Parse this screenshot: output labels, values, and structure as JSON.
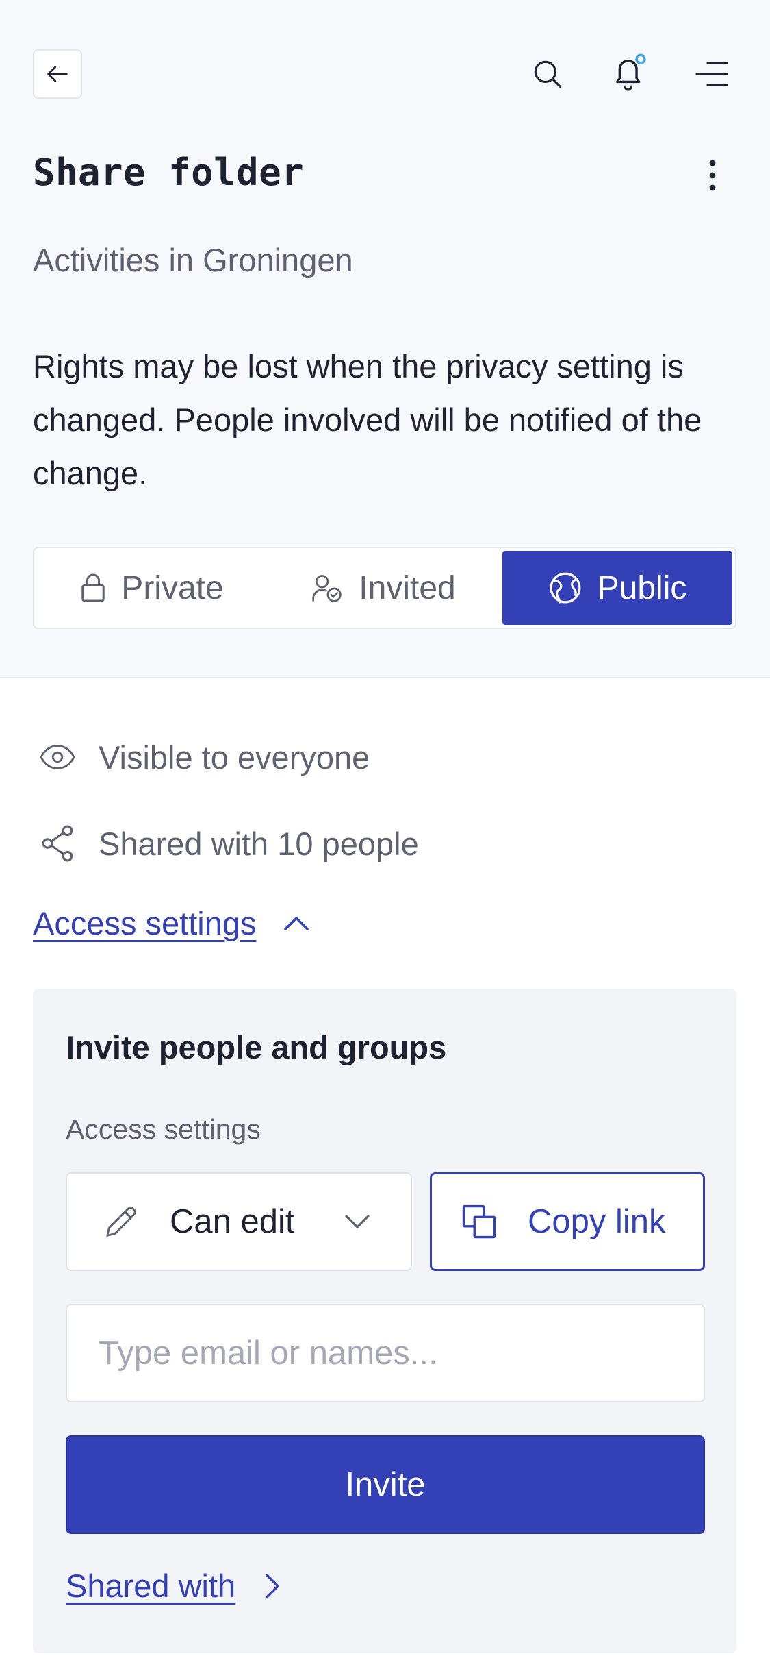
{
  "header": {
    "back_icon": "arrow-left-icon",
    "search_icon": "search-icon",
    "notifications_icon": "bell-icon",
    "notification_dot_color": "#4aa8e0",
    "menu_icon": "menu-icon",
    "title": "Share folder",
    "more_icon": "more-vertical-icon"
  },
  "folder_name": "Activities in Groningen",
  "notice": "Rights may be lost when the privacy setting is changed. People involved will be notified of the change.",
  "privacy": {
    "options": [
      {
        "label": "Private",
        "icon": "lock-icon"
      },
      {
        "label": "Invited",
        "icon": "user-check-icon"
      },
      {
        "label": "Public",
        "icon": "globe-icon"
      }
    ],
    "selected": "Public"
  },
  "info": {
    "visibility": "Visible to everyone",
    "shared_count": "Shared with 10 people"
  },
  "access_settings_toggle": "Access settings",
  "invite_panel": {
    "title": "Invite people and groups",
    "access_label": "Access settings",
    "permission_value": "Can edit",
    "copy_link_label": "Copy link",
    "email_placeholder": "Type email or names...",
    "invite_label": "Invite",
    "shared_with_link": "Shared with"
  },
  "colors": {
    "accent": "#3440b6",
    "header_bg": "#f7f8fc",
    "panel_bg": "#f3f4f8",
    "muted_text": "#5e6170"
  }
}
